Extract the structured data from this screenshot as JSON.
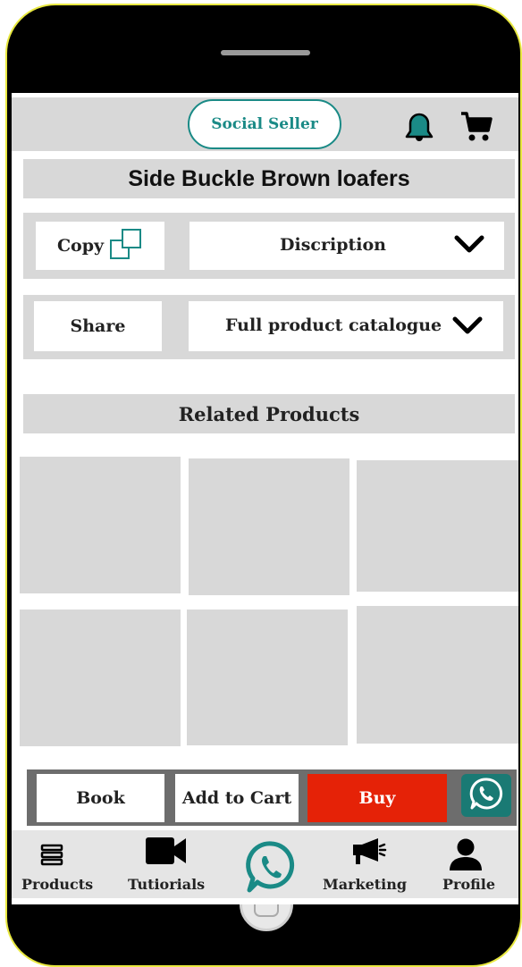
{
  "header": {
    "logo_text": "Social Seller",
    "icons": [
      "bell-icon",
      "cart-icon"
    ]
  },
  "product": {
    "title": "Side Buckle Brown loafers"
  },
  "actions": {
    "copy_label": "Copy",
    "description_label": "Discription",
    "share_label": "Share",
    "catalogue_label": "Full product catalogue"
  },
  "related": {
    "heading": "Related Products"
  },
  "purchase_bar": {
    "book_label": "Book",
    "add_to_cart_label": "Add to Cart",
    "buy_label": "Buy"
  },
  "bottom_nav": {
    "items": [
      {
        "label": "Products",
        "icon": "list-icon"
      },
      {
        "label": "Tutiorials",
        "icon": "video-camera-icon"
      },
      {
        "label": "",
        "icon": "whatsapp-icon"
      },
      {
        "label": "Marketing",
        "icon": "megaphone-icon"
      },
      {
        "label": "Profile",
        "icon": "user-icon"
      }
    ]
  },
  "colors": {
    "accent_teal": "#1a8a86",
    "buy_red": "#e52207",
    "surface_gray": "#d8d8d8"
  }
}
